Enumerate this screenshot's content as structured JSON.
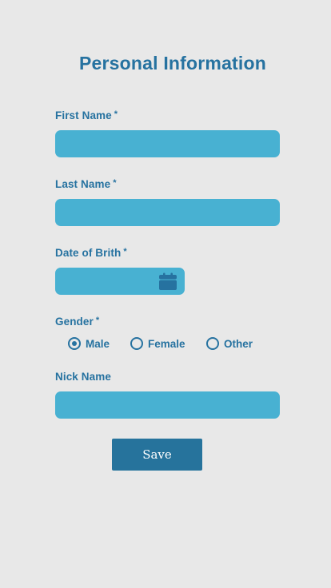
{
  "form": {
    "title": "Personal Information",
    "required_mark": "*",
    "first_name": {
      "label": "First Name",
      "value": ""
    },
    "last_name": {
      "label": "Last Name",
      "value": ""
    },
    "date_of_birth": {
      "label": "Date of Brith",
      "value": "",
      "icon": "calendar-icon"
    },
    "gender": {
      "label": "Gender",
      "options": [
        "Male",
        "Female",
        "Other"
      ],
      "selected": "Male"
    },
    "nick_name": {
      "label": "Nick Name",
      "value": ""
    },
    "save_label": "Save"
  },
  "colors": {
    "background": "#e8e8e8",
    "accent": "#2672a0",
    "input_fill": "#48b1d2",
    "button": "#26739c"
  }
}
